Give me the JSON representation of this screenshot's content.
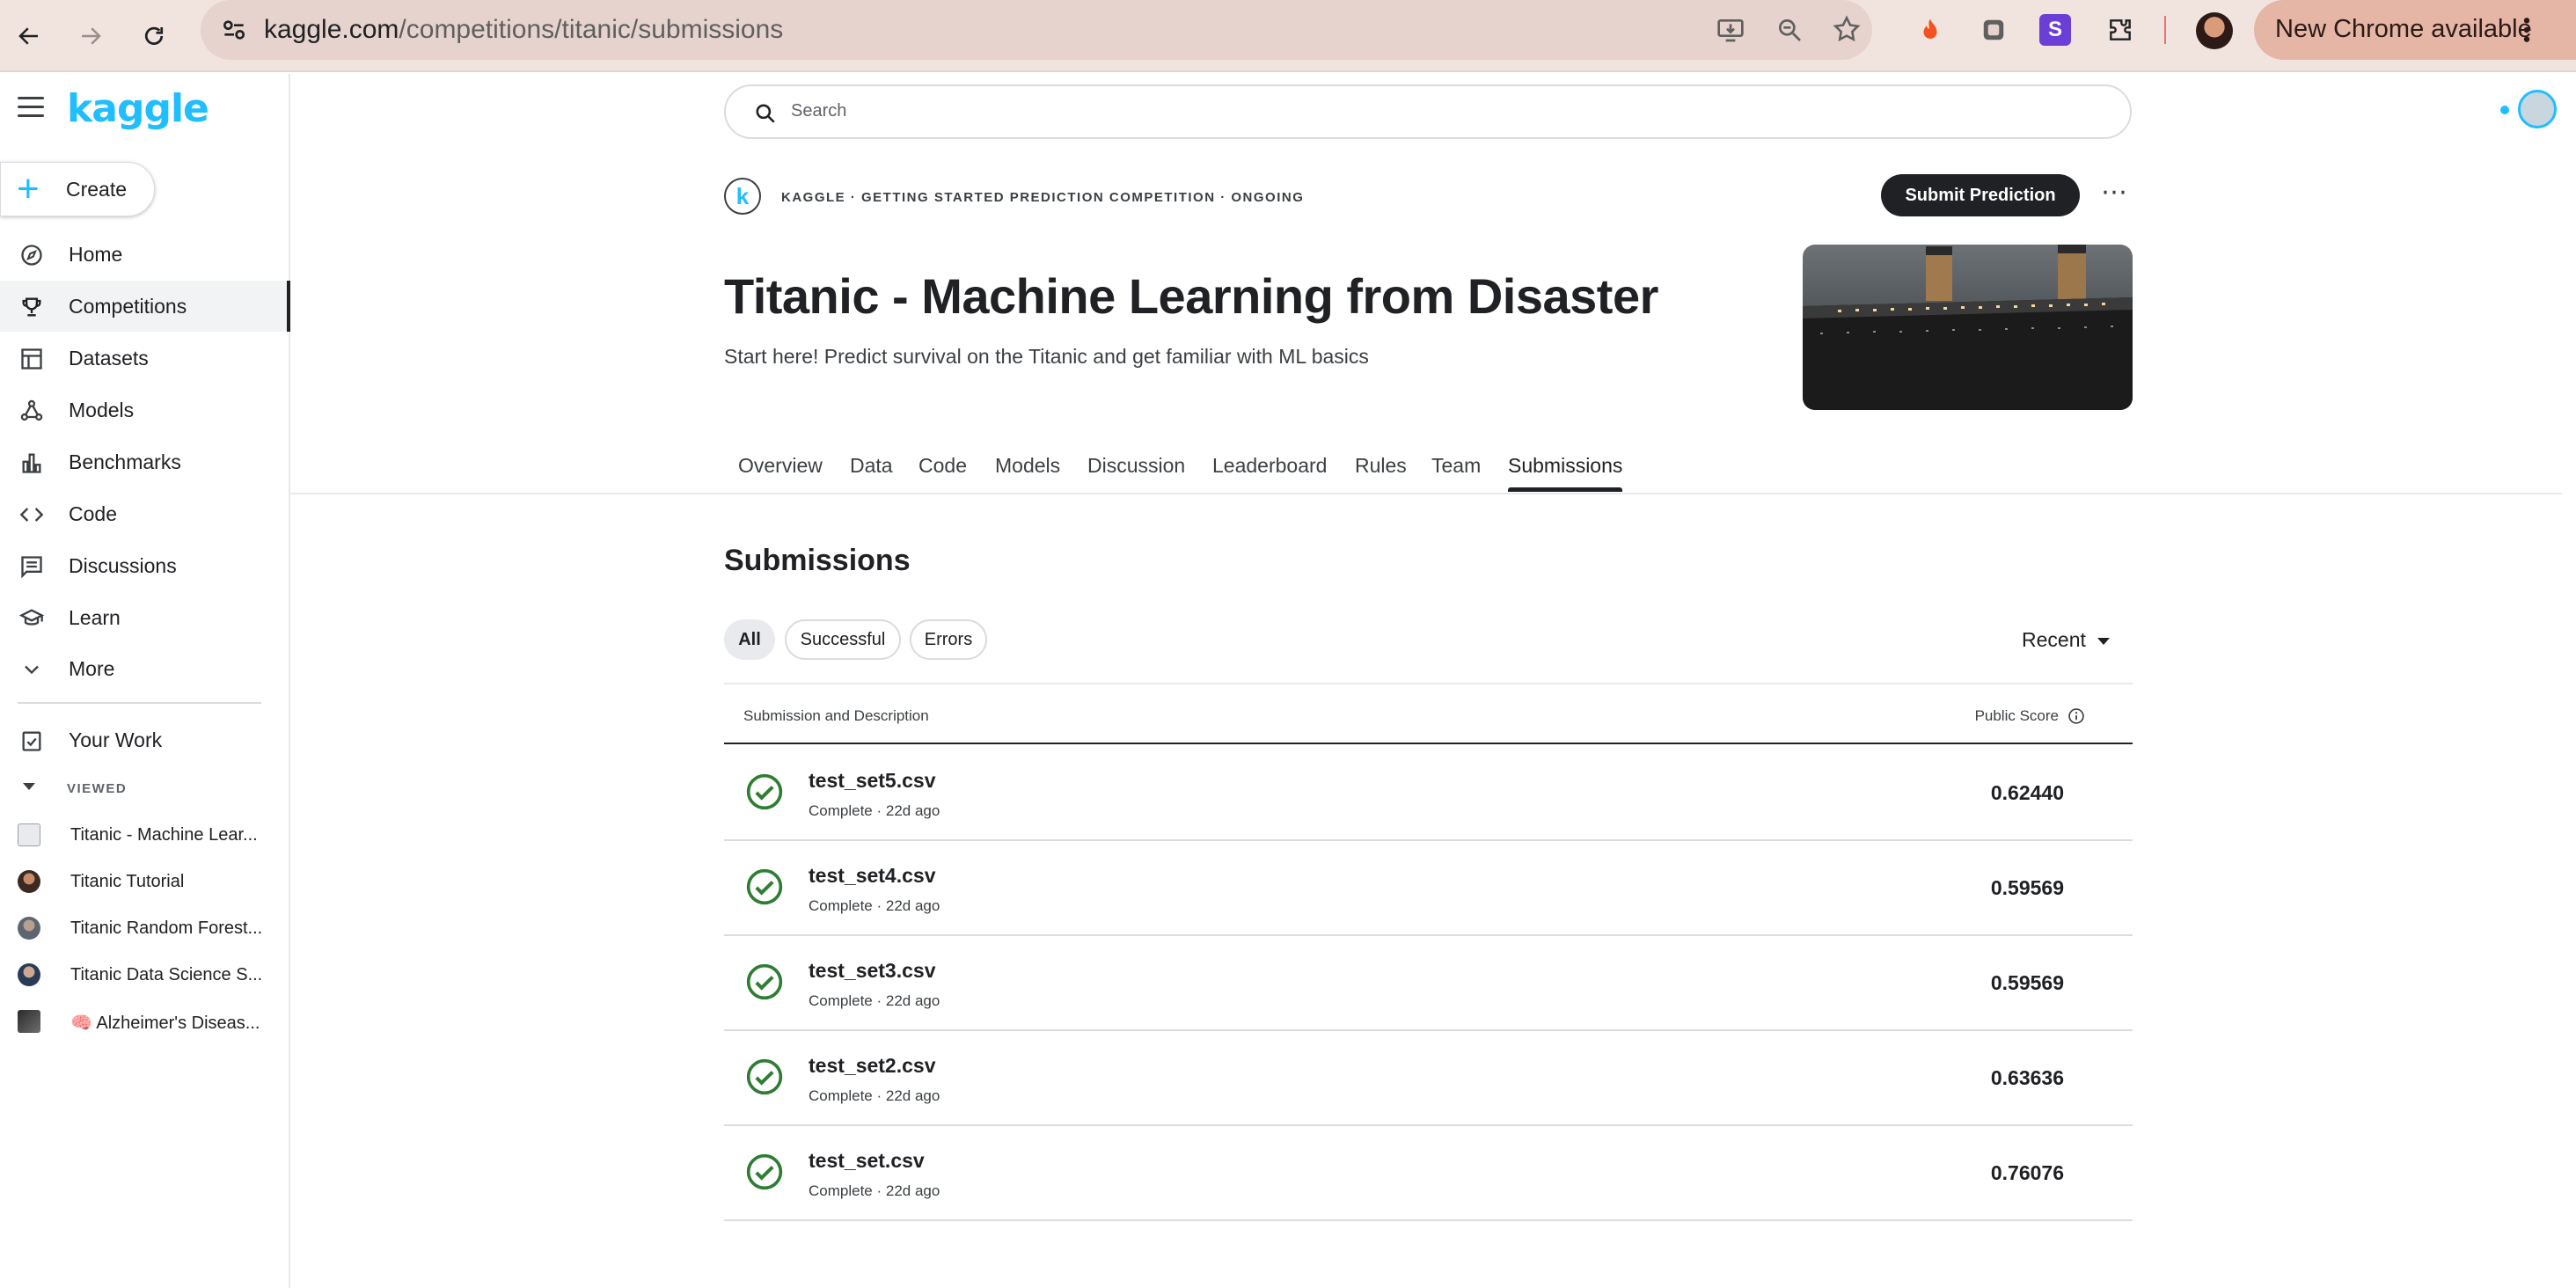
{
  "browser": {
    "url_host": "kaggle.com",
    "url_path": "/competitions/titanic/submissions",
    "update_label": "New Chrome available"
  },
  "sidebar": {
    "logo": "kaggle",
    "create_label": "Create",
    "items": [
      {
        "label": "Home",
        "icon": "compass-icon"
      },
      {
        "label": "Competitions",
        "icon": "trophy-icon",
        "active": true
      },
      {
        "label": "Datasets",
        "icon": "table-icon"
      },
      {
        "label": "Models",
        "icon": "models-icon"
      },
      {
        "label": "Benchmarks",
        "icon": "bar-chart-icon"
      },
      {
        "label": "Code",
        "icon": "code-icon"
      },
      {
        "label": "Discussions",
        "icon": "comment-icon"
      },
      {
        "label": "Learn",
        "icon": "school-icon"
      },
      {
        "label": "More",
        "icon": "chevron-down-icon"
      }
    ],
    "your_work_label": "Your Work",
    "viewed_title": "VIEWED",
    "viewed": [
      {
        "label": "Titanic - Machine Lear..."
      },
      {
        "label": "Titanic Tutorial"
      },
      {
        "label": "Titanic Random Forest..."
      },
      {
        "label": "Titanic Data Science S..."
      },
      {
        "label": "🧠 Alzheimer's Diseas..."
      }
    ]
  },
  "search": {
    "placeholder": "Search"
  },
  "competition": {
    "logo_letter": "k",
    "meta": "KAGGLE · GETTING STARTED PREDICTION COMPETITION · ONGOING",
    "submit_label": "Submit Prediction",
    "title": "Titanic - Machine Learning from Disaster",
    "subtitle": "Start here! Predict survival on the Titanic and get familiar with ML basics"
  },
  "tabs": [
    "Overview",
    "Data",
    "Code",
    "Models",
    "Discussion",
    "Leaderboard",
    "Rules",
    "Team",
    "Submissions"
  ],
  "active_tab": "Submissions",
  "submissions": {
    "title": "Submissions",
    "filters": [
      "All",
      "Successful",
      "Errors"
    ],
    "active_filter": "All",
    "sort_label": "Recent",
    "col_submission": "Submission and Description",
    "col_score": "Public Score",
    "rows": [
      {
        "file": "test_set5.csv",
        "meta": "Complete · 22d ago",
        "score": "0.62440"
      },
      {
        "file": "test_set4.csv",
        "meta": "Complete · 22d ago",
        "score": "0.59569"
      },
      {
        "file": "test_set3.csv",
        "meta": "Complete · 22d ago",
        "score": "0.59569"
      },
      {
        "file": "test_set2.csv",
        "meta": "Complete · 22d ago",
        "score": "0.63636"
      },
      {
        "file": "test_set.csv",
        "meta": "Complete · 22d ago",
        "score": "0.76076"
      }
    ]
  },
  "colors": {
    "accent": "#20beff",
    "success": "#2e7d32",
    "dark": "#202124"
  }
}
